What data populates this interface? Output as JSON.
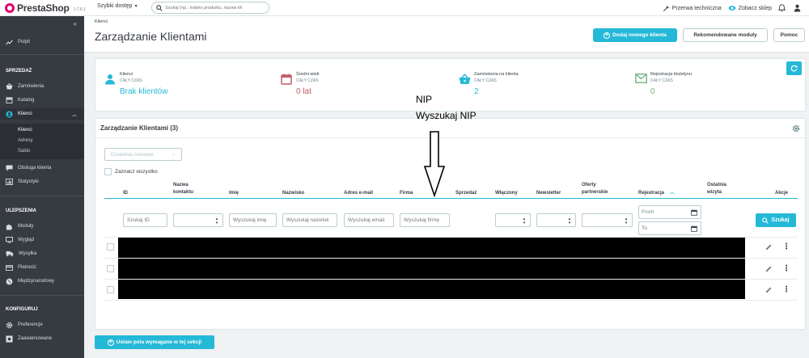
{
  "header": {
    "brand": "PrestaShop",
    "version": "1.7.6.1",
    "quick_access": "Szybki dostęp",
    "search_placeholder": "Szukaj (np.: indeks produktu, nazwa kli",
    "maintenance": "Przerwa techniczna",
    "view_shop": "Zobacz sklep"
  },
  "sidebar": {
    "dashboard": "Pulpit",
    "sections": {
      "sell": "SPRZEDAŻ",
      "improve": "ULEPSZENIA",
      "configure": "KONFIGURUJ"
    },
    "sell_items": [
      "Zamówienia",
      "Katalog",
      "Klienci"
    ],
    "customers_sub": [
      "Klienci",
      "Adresy",
      "Saldo"
    ],
    "sell_items_2": [
      "Obsługa klienta",
      "Statystyki"
    ],
    "improve_items": [
      "Moduły",
      "Wygląd",
      "Wysyłka",
      "Płatność",
      "Międzynarodowy"
    ],
    "configure_items": [
      "Preferencje",
      "Zaawansowane"
    ]
  },
  "page": {
    "breadcrumb": "Klienci",
    "title": "Zarządzanie Klientami",
    "add_button": "Dodaj nowego klienta",
    "recommended_button": "Rekomendowane moduły",
    "help_button": "Pomoc"
  },
  "kpis": [
    {
      "title": "Klienci",
      "period": "CAŁY CZAS",
      "value": "Brak klientów",
      "color": "#25b9d7",
      "icon": "user-icon"
    },
    {
      "title": "Średni wiek",
      "period": "CAŁY CZAS",
      "value": "0 lat",
      "color": "#c05c67",
      "icon": "calendar-icon"
    },
    {
      "title": "Zamówienia na klienta",
      "period": "CAŁY CZAS",
      "value": "2",
      "color": "#25b9d7",
      "icon": "basket-icon"
    },
    {
      "title": "Rejestracje biuletynu",
      "period": "CAŁY CZAS",
      "value": "0",
      "color": "#70b580",
      "icon": "envelope-icon"
    }
  ],
  "panel": {
    "title": "Zarządzanie Klientami (3)",
    "bulk_actions": "Działania masowe",
    "select_all": "Zaznacz wszystko"
  },
  "table": {
    "headers": {
      "id": "ID",
      "contact_name": "Nazwa kontaktu",
      "first_name": "Imię",
      "last_name": "Nazwisko",
      "email": "Adres e-mail",
      "company": "Firma",
      "sales": "Sprzedaż",
      "enabled": "Włączony",
      "newsletter": "Newsletter",
      "partner_offers": "Oferty partnerskie",
      "registration": "Rejestracja",
      "last_visit": "Ostatnia wizyta",
      "actions": "Akcje"
    },
    "filters": {
      "id": "Szukaj ID",
      "first_name": "Wyszukaj imię",
      "last_name": "Wyszukaj nazwisk",
      "email": "Wyszukaj email",
      "company": "Wyszukaj firmę",
      "date_from": "From",
      "date_to": "To",
      "search_button": "Szukaj"
    },
    "row_count": 3
  },
  "annotation": {
    "line1": "NIP",
    "line2": "Wyszukaj NIP"
  },
  "footer": {
    "required_fields_button": "Ustaw pola wymagane w tej sekcji"
  },
  "colors": {
    "accent": "#25b9d7",
    "sidebar_bg": "#363a41",
    "age_value": "#c05c67",
    "newsletter_value": "#70b580"
  }
}
